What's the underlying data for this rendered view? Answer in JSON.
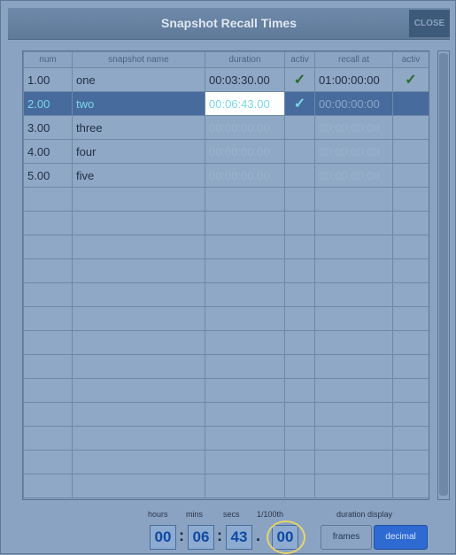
{
  "window": {
    "title": "Snapshot Recall Times",
    "close_label": "CLOSE"
  },
  "table": {
    "headers": [
      "num",
      "snapshot name",
      "duration",
      "activ",
      "recall at",
      "activ"
    ],
    "rows": [
      {
        "num": "1.00",
        "name": "one",
        "duration": "00:03:30.00",
        "duration_active": "✓",
        "recall_at": "01:00:00:00",
        "recall_active": "✓"
      },
      {
        "num": "2.00",
        "name": "two",
        "duration": "00:06:43.00",
        "duration_active": "✓",
        "recall_at": "00:00:00:00",
        "recall_active": ""
      },
      {
        "num": "3.00",
        "name": "three",
        "duration": "00:00:00.00",
        "duration_active": "",
        "recall_at": "00:00:00:00",
        "recall_active": ""
      },
      {
        "num": "4.00",
        "name": "four",
        "duration": "00:00:00.00",
        "duration_active": "",
        "recall_at": "00:00:00:00",
        "recall_active": ""
      },
      {
        "num": "5.00",
        "name": "five",
        "duration": "00:00:00.00",
        "duration_active": "",
        "recall_at": "00:00:00:00",
        "recall_active": ""
      }
    ],
    "empty_rows": 13
  },
  "time_entry": {
    "hours_label": "hours",
    "mins_label": "mins",
    "secs_label": "secs",
    "hundredths_label": "1/100th",
    "hours": "00",
    "mins": "06",
    "secs": "43",
    "hundredths": "00"
  },
  "duration_display": {
    "label": "duration display",
    "frames_label": "frames",
    "decimal_label": "decimal",
    "selected": "decimal"
  }
}
